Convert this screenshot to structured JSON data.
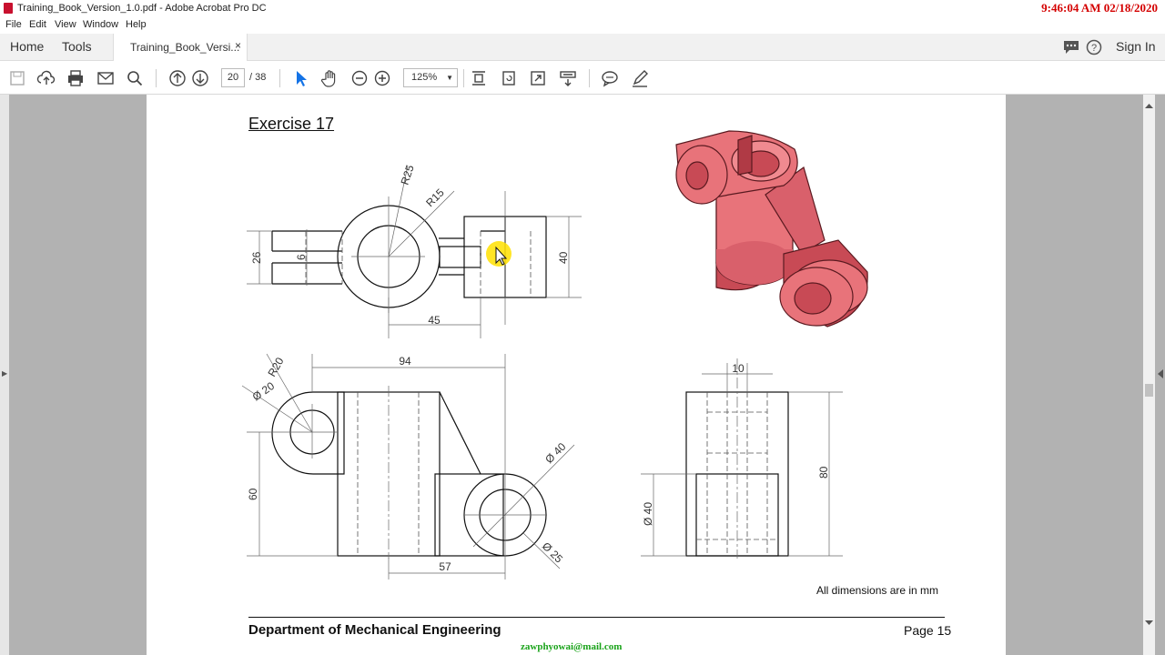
{
  "window": {
    "title": "Training_Book_Version_1.0.pdf - Adobe Acrobat Pro DC",
    "clock": "9:46:04 AM 02/18/2020"
  },
  "menu": [
    "File",
    "Edit",
    "View",
    "Window",
    "Help"
  ],
  "tabs": {
    "home": "Home",
    "tools": "Tools",
    "document": "Training_Book_Versi...",
    "close": "×",
    "sign_in": "Sign In"
  },
  "toolbar": {
    "page_current": "20",
    "page_total": "/ 38",
    "zoom": "125%",
    "icons": [
      "save-icon",
      "upload-icon",
      "print-icon",
      "email-icon",
      "search-icon",
      "prev-page-icon",
      "next-page-icon",
      "select-cursor-icon",
      "hand-icon",
      "zoom-out-icon",
      "zoom-in-icon",
      "fit-page-icon",
      "rotate-icon",
      "full-screen-icon",
      "read-mode-icon",
      "comment-icon",
      "pen-icon"
    ]
  },
  "document": {
    "exercise_title": "Exercise 17",
    "dims_note": "All dimensions are in mm",
    "footer_left": "Department of Mechanical Engineering",
    "footer_right": "Page 15",
    "dimensions": {
      "r25": "R25",
      "r15": "R15",
      "d26": "26",
      "d6": "6",
      "d40": "40",
      "d45": "45",
      "r20": "R20",
      "dia20": "Ø 20",
      "d94": "94",
      "d60": "60",
      "dia40": "Ø 40",
      "dia25": "Ø 25",
      "d57": "57",
      "d10": "10",
      "d80": "80",
      "side_dia40": "Ø 40"
    }
  },
  "watermark": "zawphyowai@mail.com",
  "colors": {
    "model_fill": "#e8737a",
    "model_dark": "#c84a55",
    "clock": "#d40000",
    "watermark": "#1aa31a",
    "highlight": "#ffe100"
  }
}
